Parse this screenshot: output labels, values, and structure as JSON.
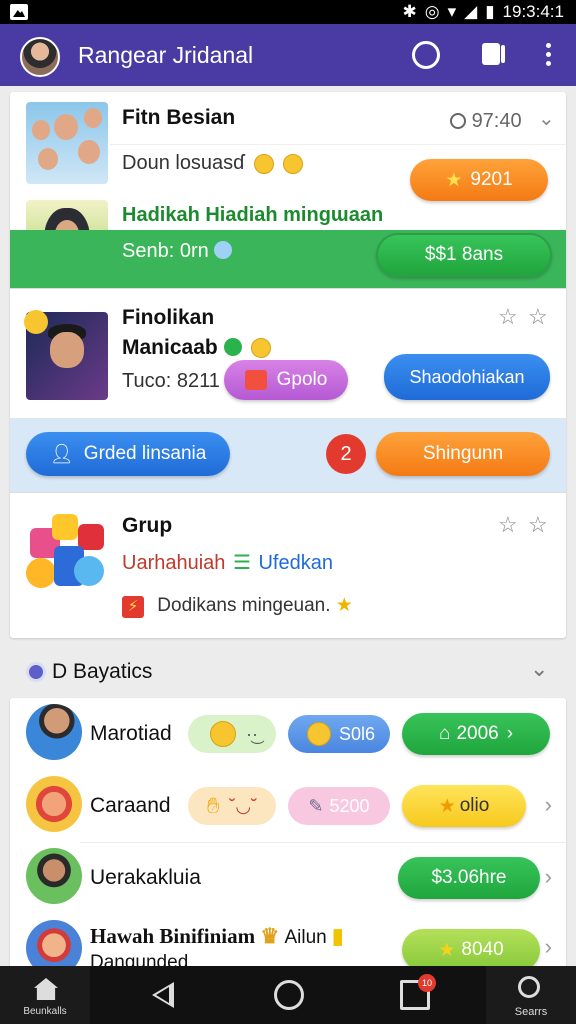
{
  "status_bar": {
    "time": "19:3:4:1"
  },
  "app_bar": {
    "title": "Rangear Jridanal"
  },
  "card1": {
    "item1": {
      "name": "Fitn Besian",
      "meta": "97:40",
      "sub": "Doun losuasɗ",
      "badge": "9201"
    },
    "item2": {
      "headline": "Hadikah Hiadiah mingɯaan",
      "sub": "Senb: 0rn",
      "price": "$$1 8ans"
    },
    "item3": {
      "name_line1": "Finolikan",
      "name_line2": "Manicaab",
      "sub": "Tuco: 8211",
      "chip": "Gpolo",
      "button": "Shaodohiakan"
    },
    "actions": {
      "left_button": "Grded linsania",
      "count": "2",
      "right_button": "Shingunn"
    },
    "item4": {
      "name": "Grup",
      "sub1": "Uarhahuiah",
      "sub1b": "Ufedkan",
      "sub2": "Dodikans mingeuan."
    }
  },
  "section": {
    "title": "D Bayatics"
  },
  "rows": [
    {
      "name": "Marotiad",
      "chip_b": "S0l6",
      "price": "2006"
    },
    {
      "name": "Caraand",
      "chip_b": "5200",
      "price": "olio"
    },
    {
      "name": "Uerakakluia",
      "price": "$3.06hre"
    },
    {
      "name": "Hawah Binifiniam",
      "sub": "Dangunded",
      "extra": "Ailun",
      "price": "8040"
    }
  ],
  "nav": {
    "home_label": "Beunkalls",
    "search_label": "Searrs",
    "recent_badge": "10"
  }
}
